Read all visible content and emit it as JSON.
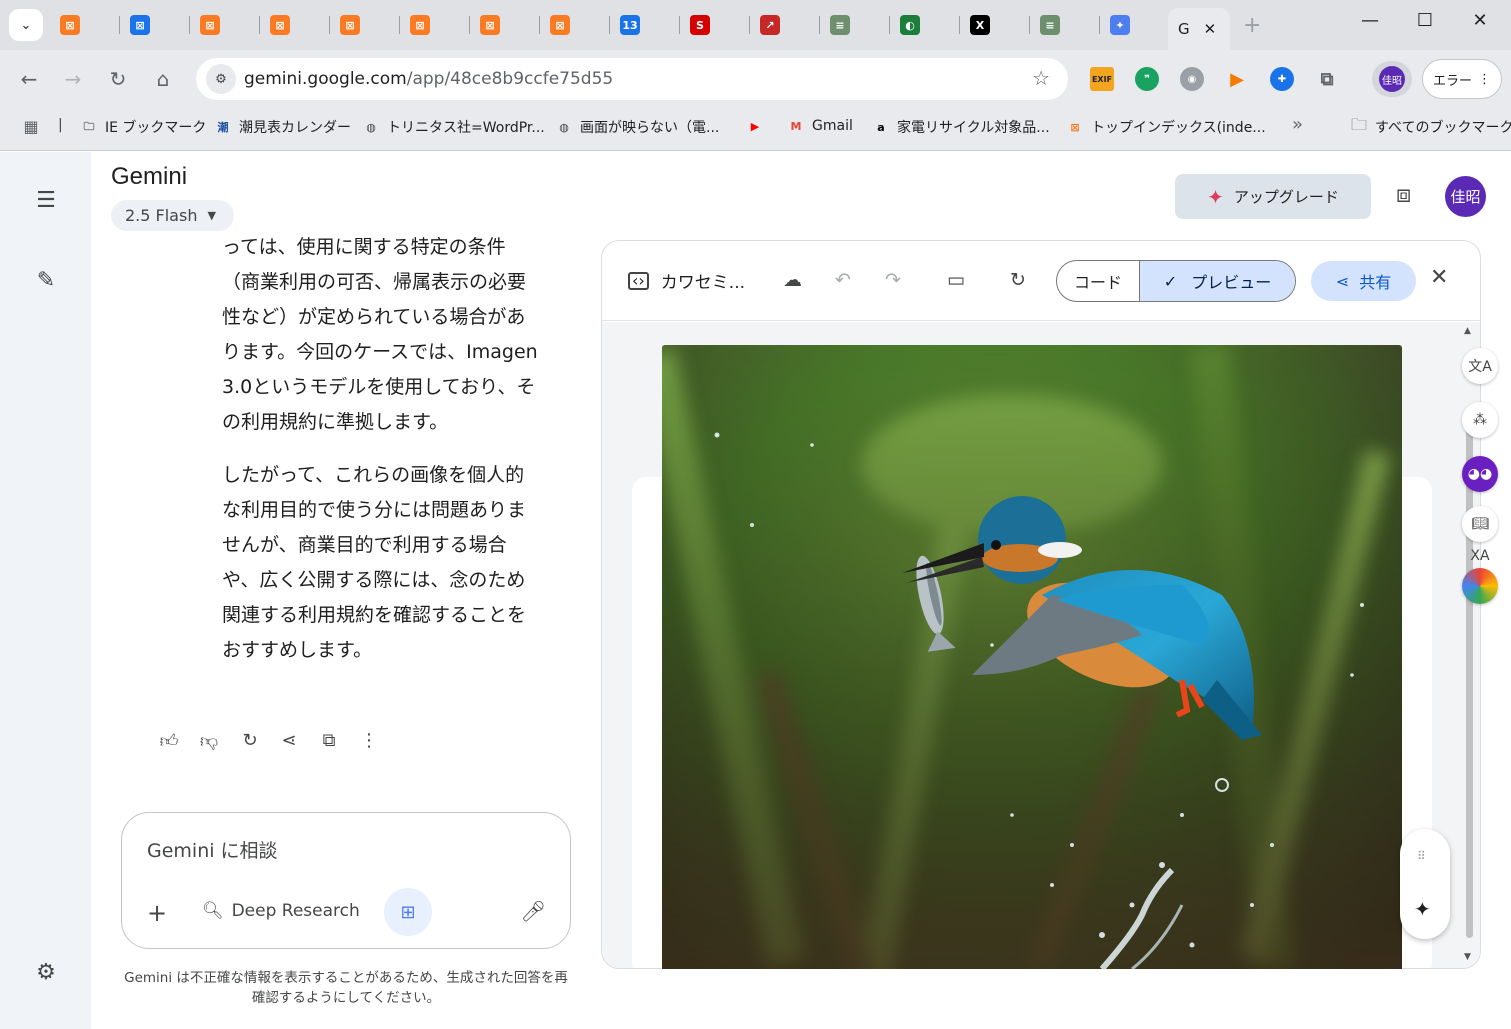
{
  "browser": {
    "tabs": [
      {
        "icon": "xampp-icon",
        "color": "#fb7a24"
      },
      {
        "icon": "box-icon",
        "color": "#1a73e8"
      },
      {
        "icon": "xampp-icon",
        "color": "#fb7a24"
      },
      {
        "icon": "xampp-icon",
        "color": "#fb7a24"
      },
      {
        "icon": "xampp-icon",
        "color": "#fb7a24"
      },
      {
        "icon": "xampp-icon",
        "color": "#fb7a24"
      },
      {
        "icon": "xampp-icon",
        "color": "#fb7a24"
      },
      {
        "icon": "xampp-icon",
        "color": "#fb7a24"
      },
      {
        "icon": "calendar-icon",
        "color": "#1a73e8",
        "glyph": "13"
      },
      {
        "icon": "red-logo-icon",
        "color": "#d50000",
        "glyph": "S"
      },
      {
        "icon": "chart-icon",
        "color": "#c62828",
        "glyph": "↗"
      },
      {
        "icon": "site-icon",
        "color": "#6d8f6d",
        "glyph": "≡"
      },
      {
        "icon": "globe-green-icon",
        "color": "#1b7f3b",
        "glyph": "◐"
      },
      {
        "icon": "x-icon",
        "color": "#000000",
        "glyph": "X"
      },
      {
        "icon": "site-icon",
        "color": "#6d8f6d",
        "glyph": "≡"
      },
      {
        "icon": "gemini-star-icon",
        "color": "#4d7ef0",
        "glyph": "✦"
      }
    ],
    "active_tab": {
      "label": "G",
      "close": "✕"
    },
    "address": {
      "host": "gemini.google.com",
      "path": "/app/48ce8b9ccfe75d55"
    },
    "profile_initials": "佳昭",
    "error_label": "エラー",
    "bookmarks": [
      {
        "label": "IE ブックマーク",
        "icon": "folder-icon"
      },
      {
        "label": "潮見表カレンダー",
        "icon": "tide-icon"
      },
      {
        "label": "トリニタス社=WordPr...",
        "icon": "globe-icon"
      },
      {
        "label": "画面が映らない（電...",
        "icon": "globe-icon"
      },
      {
        "label": "",
        "icon": "youtube-icon"
      },
      {
        "label": "Gmail",
        "icon": "gmail-icon"
      },
      {
        "label": "家電リサイクル対象品...",
        "icon": "amazon-icon"
      },
      {
        "label": "トップインデックス(inde...",
        "icon": "xampp-icon"
      }
    ],
    "all_bookmarks": "すべてのブックマーク"
  },
  "app": {
    "title": "Gemini",
    "model": "2.5 Flash",
    "upgrade": "アップグレード",
    "user_initials": "佳昭"
  },
  "chat": {
    "paragraph1": "っては、使用に関する特定の条件（商業利用の可否、帰属表示の必要性など）が定められている場合があります。今回のケースでは、Imagen 3.0というモデルを使用しており、その利用規約に準拠します。",
    "paragraph2": "したがって、これらの画像を個人的な利用目的で使う分には問題ありませんが、商業目的で利用する場合や、広く公開する際には、念のため関連する利用規約を確認することをおすすめします。"
  },
  "composer": {
    "placeholder": "Gemini に相談",
    "deep_research": "Deep Research"
  },
  "disclaimer": "Gemini は不正確な情報を表示することがあるため、生成された回答を再確認するようにしてください。",
  "canvas": {
    "doc_title": "カワセミ...",
    "code_tab": "コード",
    "preview_tab": "プレビュー",
    "share": "共有"
  }
}
